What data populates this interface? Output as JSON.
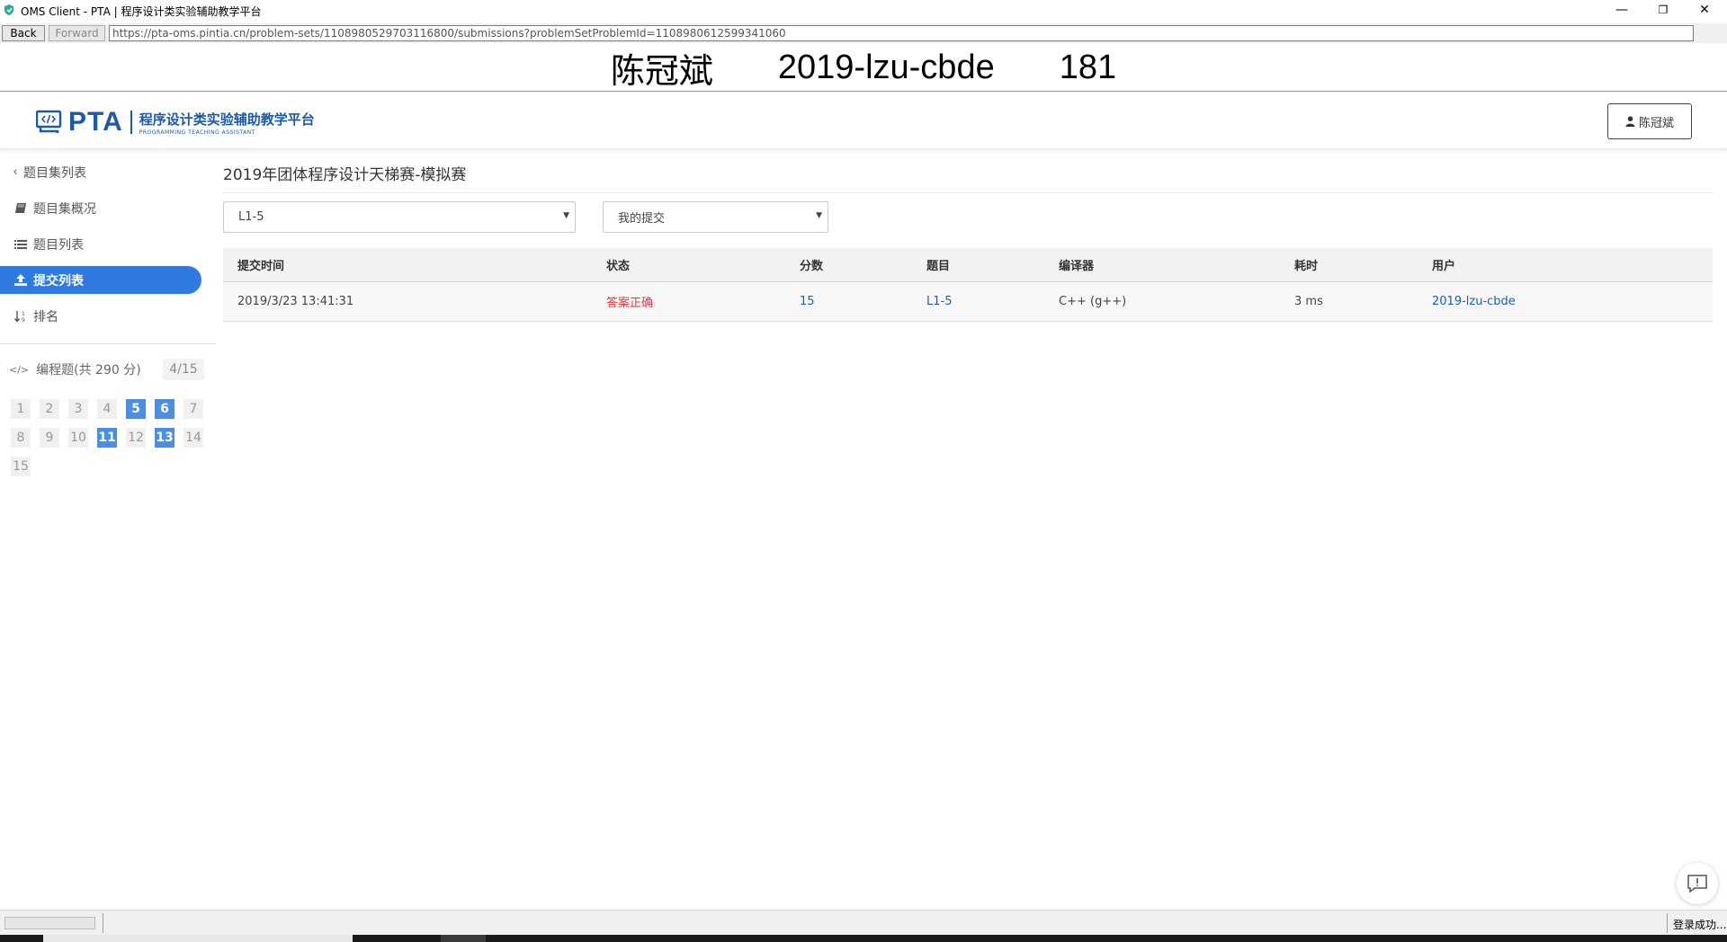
{
  "window": {
    "title": "OMS Client - PTA | 程序设计类实验辅助教学平台",
    "minimize_glyph": "—",
    "restore_glyph": "❐",
    "close_glyph": "✕"
  },
  "nav": {
    "back_label": "Back",
    "forward_label": "Forward",
    "url": "https://pta-oms.pintia.cn/problem-sets/1108980529703116800/submissions?problemSetProblemId=1108980612599341060"
  },
  "banner": {
    "name": "陈冠斌",
    "account": "2019-lzu-cbde",
    "number": "181"
  },
  "header": {
    "logo_text": "PTA",
    "logo_cn": "程序设计类实验辅助教学平台",
    "logo_en": "PROGRAMMING TEACHING ASSISTANT",
    "logo_color": "#1a5aa6",
    "user_label": "陈冠斌",
    "user_icon": "user-icon"
  },
  "sidebar": {
    "back_label": "题目集列表",
    "items": [
      {
        "label": "题目集概况",
        "icon": "book-icon",
        "active": false
      },
      {
        "label": "题目列表",
        "icon": "list-icon",
        "active": false
      },
      {
        "label": "提交列表",
        "icon": "upload-icon",
        "active": true
      },
      {
        "label": "排名",
        "icon": "sort-icon",
        "active": false
      }
    ],
    "active_color": "#2f79e0",
    "problems_label": "编程题(共 290 分)",
    "problems_icon": "code-icon",
    "progress": "4/15",
    "numbers": [
      "1",
      "2",
      "3",
      "4",
      "5",
      "6",
      "7",
      "8",
      "9",
      "10",
      "11",
      "12",
      "13",
      "14",
      "15"
    ],
    "solved": [
      "5",
      "6",
      "11",
      "13"
    ]
  },
  "main": {
    "title": "2019年团体程序设计天梯赛-模拟赛",
    "problem_select": "L1-5",
    "scope_select": "我的提交",
    "table": {
      "headers": [
        "提交时间",
        "状态",
        "分数",
        "题目",
        "编译器",
        "耗时",
        "用户"
      ],
      "rows": [
        {
          "time": "2019/3/23 13:41:31",
          "status": "答案正确",
          "score": "15",
          "problem": "L1-5",
          "compiler": "C++ (g++)",
          "elapsed": "3 ms",
          "user": "2019-lzu-cbde"
        }
      ]
    },
    "status_ok_color": "#e0383e",
    "link_color": "#1d5fae"
  },
  "feedback_icon": "feedback-icon",
  "statusbar": {
    "text": "登录成功...",
    "progress_fraction": 0.0
  }
}
